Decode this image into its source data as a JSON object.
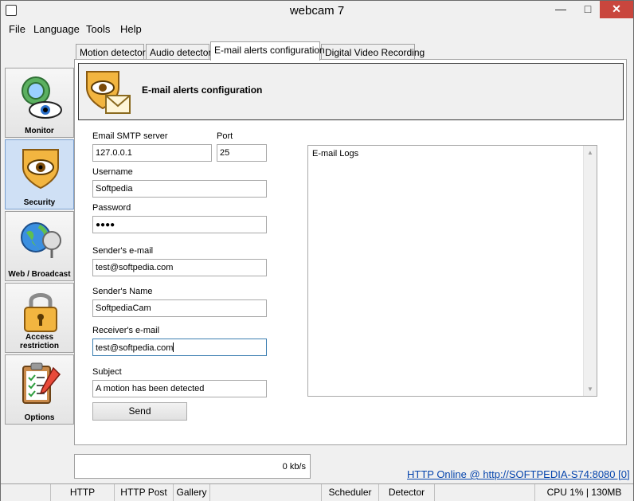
{
  "window": {
    "title": "webcam 7"
  },
  "menu": {
    "file": "File",
    "language": "Language",
    "tools": "Tools",
    "help": "Help"
  },
  "sidebar": {
    "items": [
      {
        "label": "Monitor",
        "icon": "monitor-eye-icon"
      },
      {
        "label": "Security",
        "icon": "security-shield-icon"
      },
      {
        "label": "Web / Broadcast",
        "icon": "globe-broadcast-icon"
      },
      {
        "label": "Access restriction",
        "icon": "padlock-icon"
      },
      {
        "label": "Options",
        "icon": "clipboard-options-icon"
      }
    ]
  },
  "tabs": [
    {
      "label": "Motion detector"
    },
    {
      "label": "Audio detector"
    },
    {
      "label": "E-mail alerts configuration"
    },
    {
      "label": "Digital Video Recording"
    }
  ],
  "header": {
    "title": "E-mail alerts configuration"
  },
  "form": {
    "smtp_label": "Email SMTP server",
    "smtp_value": "127.0.0.1",
    "port_label": "Port",
    "port_value": "25",
    "username_label": "Username",
    "username_value": "Softpedia",
    "password_label": "Password",
    "password_value": "●●●●",
    "sender_email_label": "Sender's e-mail",
    "sender_email_value": "test@softpedia.com",
    "sender_name_label": "Sender's Name",
    "sender_name_value": "SoftpediaCam",
    "receiver_label": "Receiver's e-mail",
    "receiver_value": "test@softpedia.com",
    "subject_label": "Subject",
    "subject_value": "A motion has been detected",
    "send_label": "Send"
  },
  "logs": {
    "label": "E-mail Logs"
  },
  "bandwidth": {
    "value": "0 kb/s"
  },
  "http_status": "HTTP Online @ http://SOFTPEDIA-S74:8080 [0]",
  "statusbar": {
    "http": "HTTP",
    "http_post": "HTTP Post",
    "gallery": "Gallery",
    "scheduler": "Scheduler",
    "detector": "Detector",
    "cpu": "CPU 1% | 130MB"
  },
  "colors": {
    "active_sidebar": "#cfe0f5",
    "close_button": "#c9463d",
    "link": "#0645ad"
  }
}
